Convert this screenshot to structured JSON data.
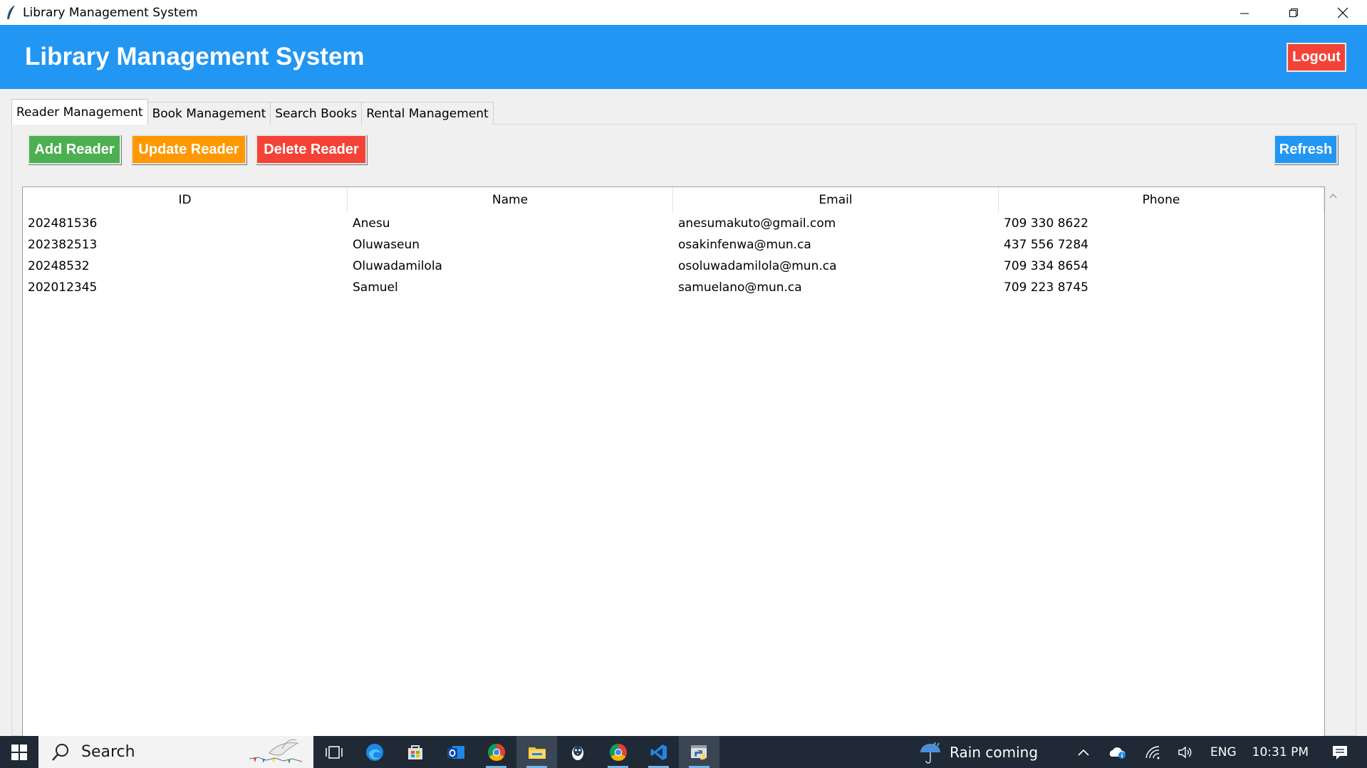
{
  "window": {
    "title": "Library Management System"
  },
  "header": {
    "title": "Library Management System",
    "logout_label": "Logout"
  },
  "tabs": [
    {
      "label": "Reader Management",
      "active": true
    },
    {
      "label": "Book Management",
      "active": false
    },
    {
      "label": "Search Books",
      "active": false
    },
    {
      "label": "Rental Management",
      "active": false
    }
  ],
  "actions": {
    "add_label": "Add Reader",
    "update_label": "Update Reader",
    "delete_label": "Delete Reader",
    "refresh_label": "Refresh"
  },
  "table": {
    "columns": [
      "ID",
      "Name",
      "Email",
      "Phone"
    ],
    "rows": [
      [
        "202481536",
        "Anesu",
        "anesumakuto@gmail.com",
        "709 330 8622"
      ],
      [
        "202382513",
        "Oluwaseun",
        "osakinfenwa@mun.ca",
        "437 556 7284"
      ],
      [
        "20248532",
        "Oluwadamilola",
        "osoluwadamilola@mun.ca",
        "709 334 8654"
      ],
      [
        "202012345",
        "Samuel",
        "samuelano@mun.ca",
        "709 223 8745"
      ]
    ]
  },
  "taskbar": {
    "search_placeholder": "Search",
    "weather": "Rain coming",
    "language": "ENG",
    "time": "10:31 PM"
  },
  "colors": {
    "header": "#2196f3",
    "add": "#4caf50",
    "update": "#ff9800",
    "delete": "#f44336",
    "refresh": "#2196f3",
    "taskbar": "#1f2a36"
  }
}
